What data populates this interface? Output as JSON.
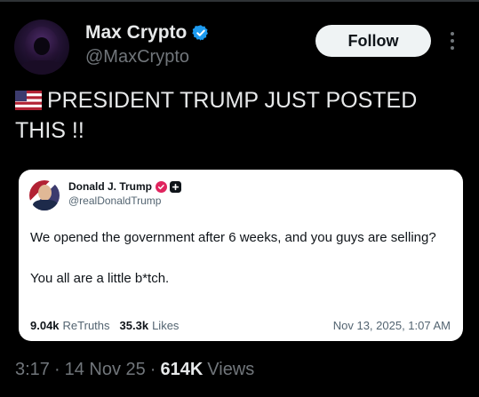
{
  "author": {
    "name": "Max Crypto",
    "handle": "@MaxCrypto",
    "verified_color": "#1d9bf0"
  },
  "follow_label": "Follow",
  "post": {
    "flag_icon": "us-flag-icon",
    "text": "PRESIDENT TRUMP JUST POSTED THIS !!"
  },
  "quote": {
    "name": "Donald J. Trump",
    "handle": "@realDonaldTrump",
    "badge_color": "#e0245e",
    "line1": "We opened the government after 6 weeks, and you guys are selling?",
    "line2": "You all are a little b*tch.",
    "retruths_count": "9.04k",
    "retruths_label": "ReTruths",
    "likes_count": "35.3k",
    "likes_label": "Likes",
    "date": "Nov 13, 2025, 1:07 AM"
  },
  "meta": {
    "time": "3:17",
    "separator": "·",
    "date": "14 Nov 25",
    "views_count": "614K",
    "views_label": "Views"
  }
}
